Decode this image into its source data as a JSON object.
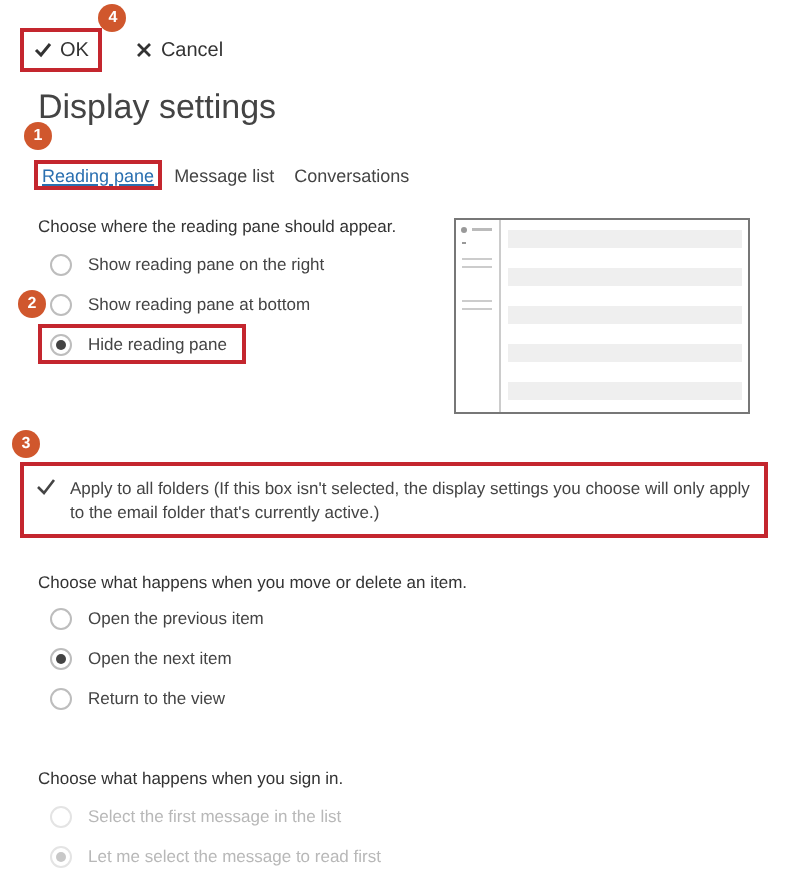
{
  "toolbar": [
    {
      "label": "OK",
      "kind": "confirm",
      "highlighted": true,
      "badge": "4"
    },
    {
      "label": "Cancel",
      "kind": "cancel",
      "highlighted": false
    }
  ],
  "title": "Display settings",
  "tabs": [
    {
      "label": "Reading pane",
      "selected": true,
      "highlighted": true,
      "badge": "1"
    },
    {
      "label": "Message list",
      "selected": false,
      "highlighted": false
    },
    {
      "label": "Conversations",
      "selected": false,
      "highlighted": false
    }
  ],
  "reading_pane": {
    "prompt": "Choose where the reading pane should appear.",
    "options": [
      {
        "label": "Show reading pane on the right",
        "selected": false,
        "highlighted": false
      },
      {
        "label": "Show reading pane at bottom",
        "selected": false,
        "highlighted": false,
        "badge": "2"
      },
      {
        "label": "Hide reading pane",
        "selected": true,
        "highlighted": true
      }
    ]
  },
  "apply_all": {
    "label": "Apply to all folders (If this box isn't selected, the display settings you choose will only apply to the email folder that's currently active.)",
    "checked": true,
    "highlighted": true,
    "badge": "3"
  },
  "sections": [
    {
      "prompt": "Choose what happens when you move or delete an item.",
      "options": [
        {
          "label": "Open the previous item",
          "selected": false,
          "disabled": false
        },
        {
          "label": "Open the next item",
          "selected": true,
          "disabled": false
        },
        {
          "label": "Return to the view",
          "selected": false,
          "disabled": false
        }
      ]
    },
    {
      "prompt": "Choose what happens when you sign in.",
      "options": [
        {
          "label": "Select the first message in the list",
          "selected": false,
          "disabled": true
        },
        {
          "label": "Let me select the message to read first",
          "selected": true,
          "disabled": true
        }
      ]
    }
  ]
}
